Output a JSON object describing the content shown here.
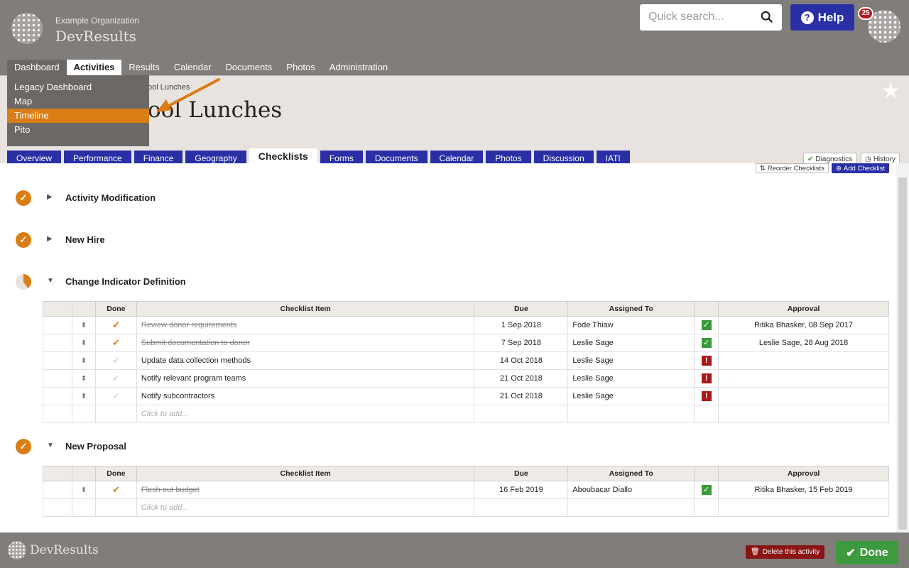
{
  "header": {
    "org_name": "Example Organization",
    "brand": "DevResults",
    "search_placeholder": "Quick search...",
    "help_label": "Help",
    "notification_count": "25"
  },
  "nav": {
    "items": [
      "Dashboard",
      "Activities",
      "Results",
      "Calendar",
      "Documents",
      "Photos",
      "Administration"
    ],
    "active": "Activities"
  },
  "dropdown": {
    "items": [
      "Legacy Dashboard",
      "Map",
      "Timeline",
      "Pito"
    ],
    "highlighted": "Timeline"
  },
  "breadcrumb": "ool Lunches",
  "page_title": "ool Lunches",
  "tabs": [
    "Overview",
    "Performance",
    "Finance",
    "Geography",
    "Checklists",
    "Forms",
    "Documents",
    "Calendar",
    "Photos",
    "Discussion",
    "IATI"
  ],
  "active_tab": "Checklists",
  "side_buttons": {
    "diagnostics": "Diagnostics",
    "history": "History"
  },
  "top_actions": {
    "reorder": "Reorder Checklists",
    "add": "Add Checklist"
  },
  "columns": {
    "done": "Done",
    "item": "Checklist Item",
    "due": "Due",
    "assigned": "Assigned To",
    "approval": "Approval"
  },
  "add_placeholder": "Click to add...",
  "sections": [
    {
      "title": "Activity Modification",
      "status": "complete",
      "expanded": false
    },
    {
      "title": "New Hire",
      "status": "complete",
      "expanded": false
    },
    {
      "title": "Change Indicator Definition",
      "status": "partial",
      "expanded": true,
      "rows": [
        {
          "done": true,
          "item": "Review donor requirements",
          "due": "1 Sep 2018",
          "assigned": "Fode Thiaw",
          "approved": true,
          "approval": "Ritika Bhasker, 08 Sep 2017"
        },
        {
          "done": true,
          "item": "Submit documentation to donor",
          "due": "7 Sep 2018",
          "assigned": "Leslie Sage",
          "approved": true,
          "approval": "Leslie Sage, 28 Aug 2018"
        },
        {
          "done": false,
          "item": "Update data collection methods",
          "due": "14 Oct 2018",
          "assigned": "Leslie Sage",
          "approved": false,
          "approval": ""
        },
        {
          "done": false,
          "item": "Notify relevant program teams",
          "due": "21 Oct 2018",
          "assigned": "Leslie Sage",
          "approved": false,
          "approval": ""
        },
        {
          "done": false,
          "item": "Notify subcontractors",
          "due": "21 Oct 2018",
          "assigned": "Leslie Sage",
          "approved": false,
          "approval": ""
        }
      ]
    },
    {
      "title": "New Proposal",
      "status": "complete",
      "expanded": true,
      "rows": [
        {
          "done": true,
          "item": "Flesh out budget",
          "due": "16 Feb 2019",
          "assigned": "Aboubacar Diallo",
          "approved": true,
          "approval": "Ritika Bhasker, 15 Feb 2019"
        }
      ]
    }
  ],
  "footer": {
    "brand": "DevResults",
    "delete_label": "Delete this activity",
    "done_label": "Done"
  },
  "colors": {
    "accent": "#d97d14",
    "primary": "#2a2fa6",
    "header_bg": "#807d7b",
    "success": "#3e9a3e",
    "danger": "#8a1313"
  }
}
